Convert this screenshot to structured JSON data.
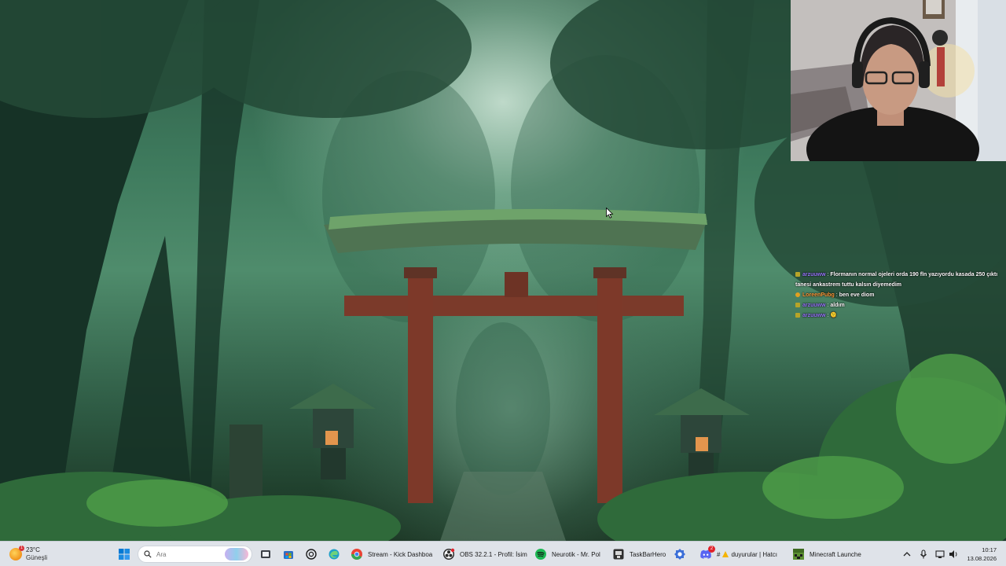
{
  "chat": {
    "messages": [
      {
        "user": "arzuuww",
        "text": "Flormanın normal ojeleri orda 190 fln yazıyordu kasada 250 çıktı tanesi ankastrem tuttu kalsın diyemedim",
        "badge_color": "#b7a428",
        "user_color": "#9a7cff"
      },
      {
        "user": "LoreenPubg",
        "text": "ben eve diom",
        "badge_color": "#e0a020",
        "user_color": "#ff9d3c"
      },
      {
        "user": "arzuuww",
        "text": "aldım",
        "badge_color": "#b7a428",
        "user_color": "#9a7cff"
      },
      {
        "user": "arzuuww",
        "text": "🫠",
        "badge_color": "#b7a428",
        "user_color": "#9a7cff"
      }
    ]
  },
  "taskbar": {
    "weather": {
      "temp": "23°C",
      "condition": "Güneşli",
      "badge": "1"
    },
    "search": {
      "placeholder": "Ara"
    },
    "apps": [
      {
        "label": "Stream - Kick Dashboa",
        "icon": "chrome-icon"
      },
      {
        "label": "OBS 32.2.1 - Profil: İsim",
        "icon": "obs-icon"
      },
      {
        "label": "Neurotik - Mr. Pol",
        "icon": "spotify-icon"
      },
      {
        "label": "TaskBarHero",
        "icon": "taskbarhero-icon"
      },
      {
        "label": "#",
        "icon": "discord-icon"
      },
      {
        "label": "duyurular | Hatcı",
        "icon": "discord-channel-icon"
      },
      {
        "label": "Minecraft Launche",
        "icon": "minecraft-icon"
      }
    ],
    "discord_badge": "2",
    "clock": {
      "time": "10:17",
      "date": "13.08.2026"
    }
  },
  "colors": {
    "taskbar_bg": "#dfe3e9",
    "chrome_red": "#ea4335",
    "spotify_green": "#1db954",
    "discord_blurple": "#5865f2",
    "windows_blue": "#0078d4"
  }
}
